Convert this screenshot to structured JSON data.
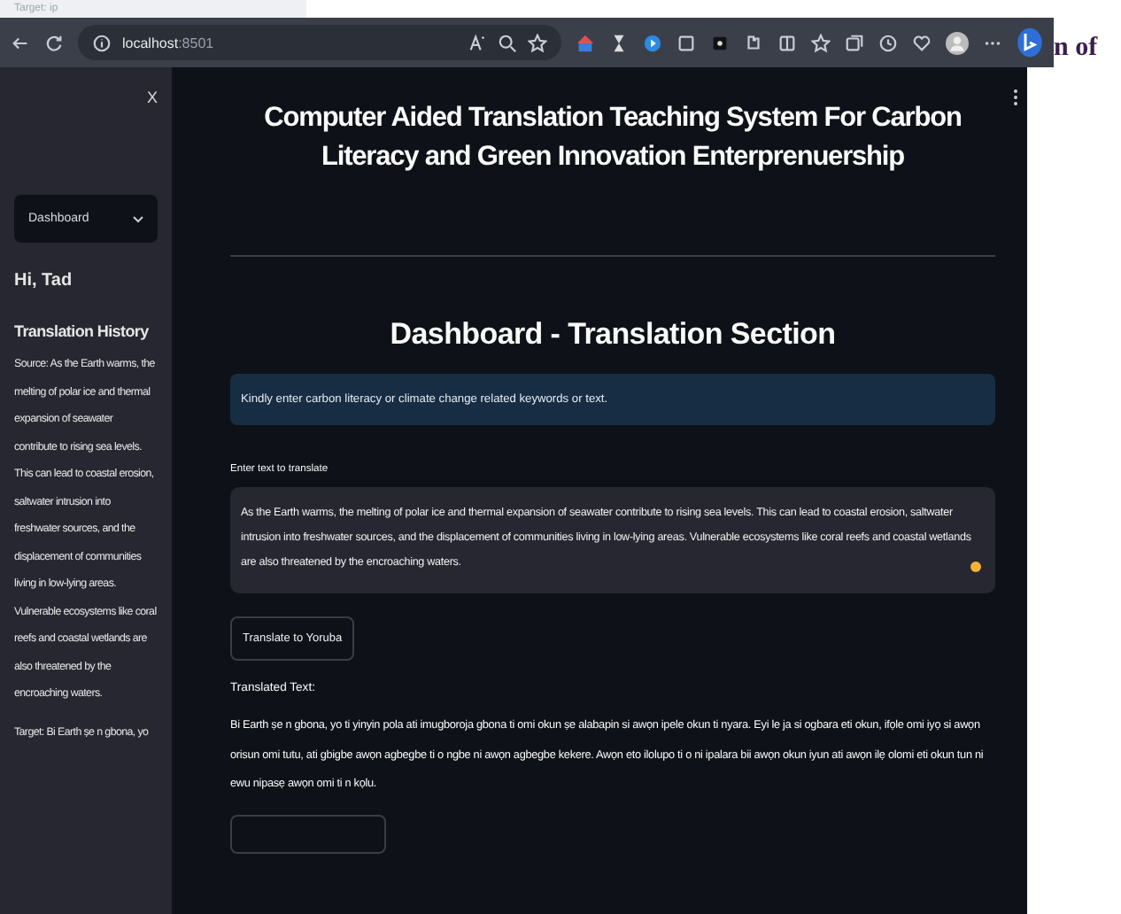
{
  "page_behind": {
    "caption": "Target: ip",
    "heading_fragment": "n of"
  },
  "browser": {
    "url_host": "localhost",
    "url_port": ":8501"
  },
  "sidebar": {
    "close": "X",
    "nav_select": {
      "value": "Dashboard"
    },
    "greeting": "Hi, Tad",
    "history_title": "Translation History",
    "history": [
      {
        "text": "Source: As the Earth warms, the melting of polar ice and thermal expansion of seawater contribute to rising sea levels. This can lead to coastal erosion, saltwater intrusion into freshwater sources, and the displacement of communities living in low-lying areas. Vulnerable ecosystems like coral reefs and coastal wetlands are also threatened by the encroaching waters."
      },
      {
        "text": "Target: Bi Earth ṣe n gbona, yo"
      }
    ]
  },
  "main": {
    "title": "Computer Aided Translation Teaching System For Carbon Literacy and Green Innovation Enterprenuership",
    "section_title": "Dashboard - Translation Section",
    "info": "Kindly enter carbon literacy or climate change related keywords or text.",
    "input": {
      "label": "Enter text to translate",
      "value": "As the Earth warms, the melting of polar ice and thermal expansion of seawater contribute to rising sea levels. This can lead to coastal erosion, saltwater intrusion into freshwater sources, and the displacement of communities living in low-lying areas. Vulnerable ecosystems like coral reefs and coastal wetlands are also threatened by the encroaching waters."
    },
    "translate_button": "Translate to Yoruba",
    "output_label": "Translated Text:",
    "output_text": "Bi Earth ṣe n gbona, yo ti yinyin pola ati imugboroja gbona ti omi okun ṣe alabapin si awọn ipele okun ti nyara. Eyi le ja si ogbara eti okun, ifọle omi iyọ si awọn orisun omi tutu, ati gbigbe awọn agbegbe ti o ngbe ni awọn agbegbe kekere. Awọn eto ilolupo ti o ni ipalara bii awọn okun iyun ati awọn ilẹ olomi eti okun tun ni ewu nipasẹ awọn omi ti n kọlu."
  }
}
